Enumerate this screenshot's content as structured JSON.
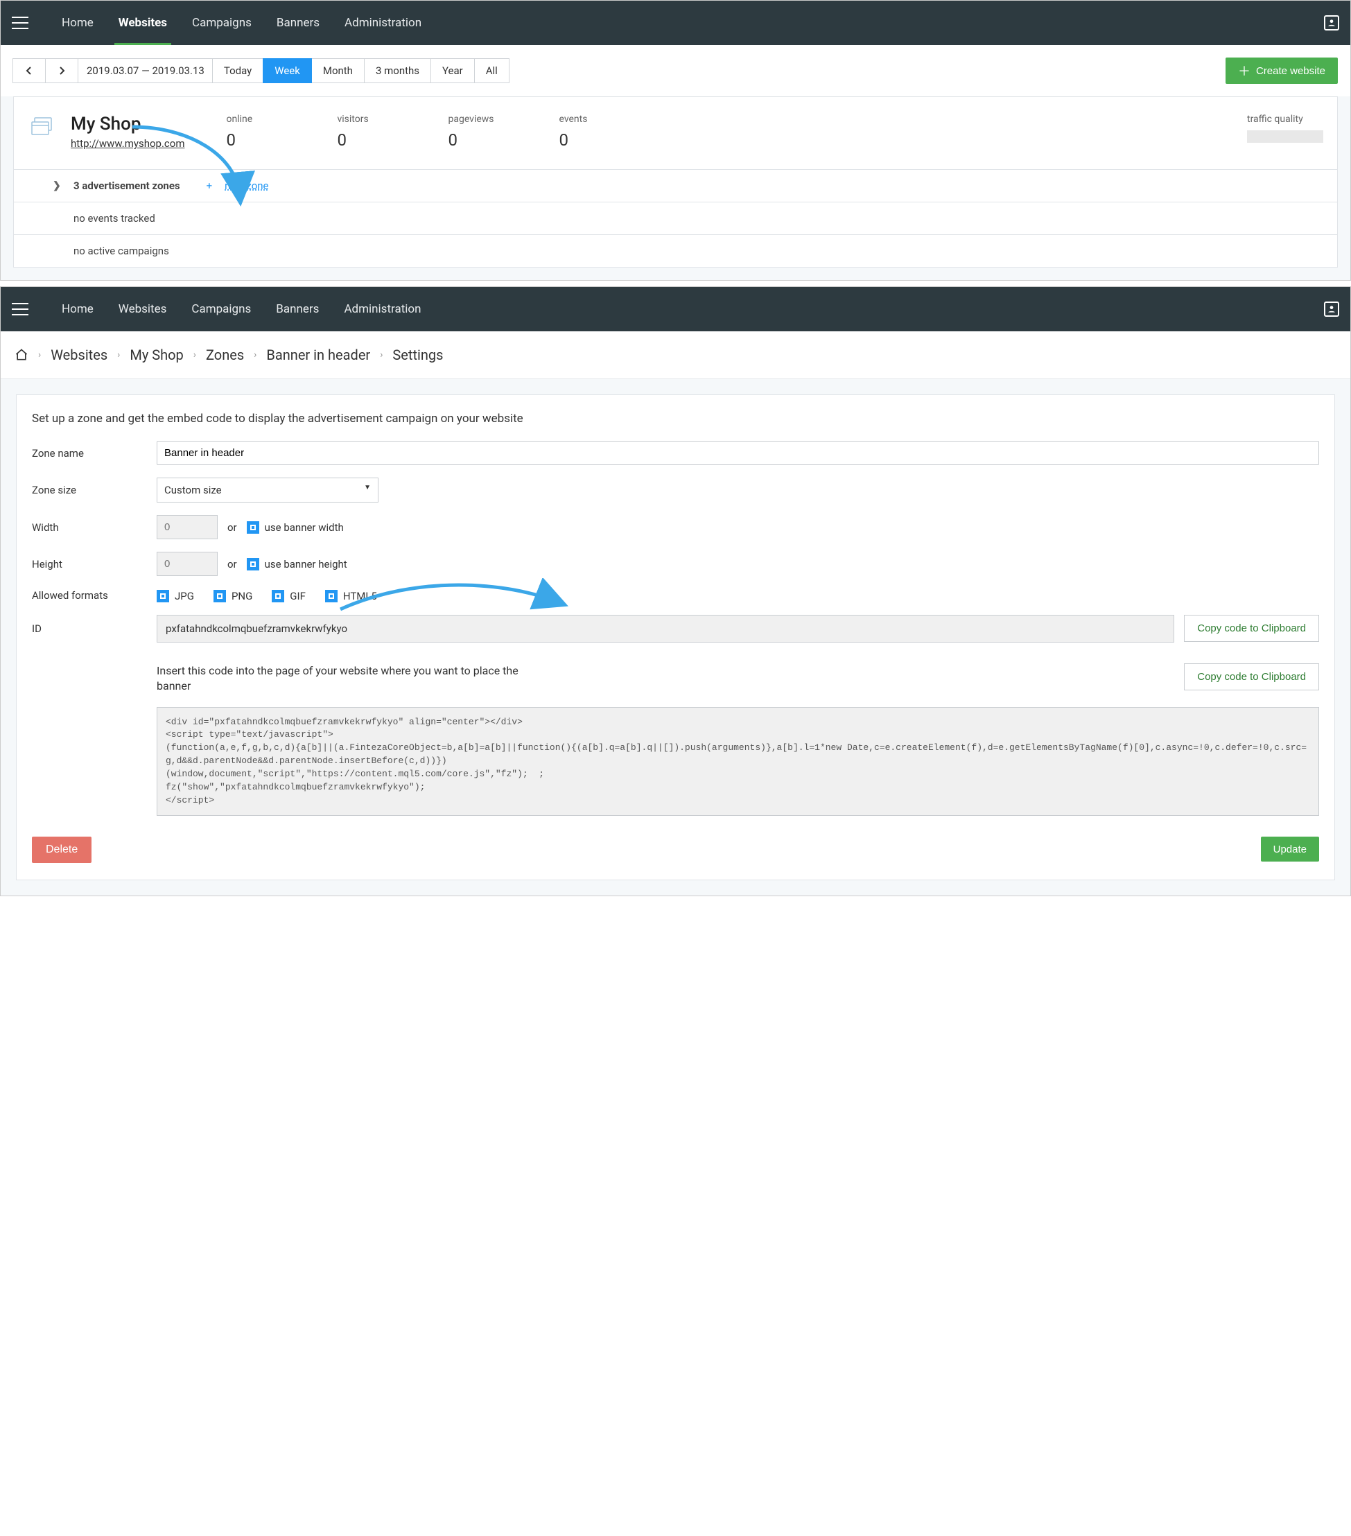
{
  "nav": {
    "items": [
      {
        "label": "Home"
      },
      {
        "label": "Websites"
      },
      {
        "label": "Campaigns"
      },
      {
        "label": "Banners"
      },
      {
        "label": "Administration"
      }
    ]
  },
  "toolbar": {
    "date_range": "2019.03.07  — 2019.03.13",
    "ranges": [
      "Today",
      "Week",
      "Month",
      "3 months",
      "Year",
      "All"
    ],
    "create_website": "Create website"
  },
  "site": {
    "name": "My Shop",
    "url": "http://www.myshop.com",
    "stats": {
      "online_label": "online",
      "online": "0",
      "visitors_label": "visitors",
      "visitors": "0",
      "pageviews_label": "pageviews",
      "pageviews": "0",
      "events_label": "events",
      "events": "0",
      "quality_label": "traffic quality"
    },
    "zones_row": "3 advertisement zones",
    "new_zone": "new zone",
    "no_events": "no events tracked",
    "no_campaigns": "no active campaigns"
  },
  "breadcrumb": {
    "items": [
      "Websites",
      "My Shop",
      "Zones",
      "Banner in header",
      "Settings"
    ]
  },
  "settings": {
    "description": "Set up a zone and get the embed code to display the advertisement campaign on your website",
    "zone_name_label": "Zone name",
    "zone_name_value": "Banner in header",
    "zone_size_label": "Zone size",
    "zone_size_value": "Custom size",
    "width_label": "Width",
    "width_placeholder": "0",
    "or_text": "or",
    "use_banner_width": "use banner width",
    "height_label": "Height",
    "height_placeholder": "0",
    "use_banner_height": "use banner height",
    "formats_label": "Allowed formats",
    "formats": [
      "JPG",
      "PNG",
      "GIF",
      "HTML5"
    ],
    "id_label": "ID",
    "id_value": "pxfatahndkcolmqbuefzramvkekrwfykyo",
    "copy_btn": "Copy code to Clipboard",
    "code_instruct": "Insert this code into the page of your website where you want to place the banner",
    "code_block": "<div id=\"pxfatahndkcolmqbuefzramvkekrwfykyo\" align=\"center\"></div>\n<script type=\"text/javascript\">\n(function(a,e,f,g,b,c,d){a[b]||(a.FintezaCoreObject=b,a[b]=a[b]||function(){(a[b].q=a[b].q||[]).push(arguments)},a[b].l=1*new Date,c=e.createElement(f),d=e.getElementsByTagName(f)[0],c.async=!0,c.defer=!0,c.src=g,d&&d.parentNode&&d.parentNode.insertBefore(c,d))})\n(window,document,\"script\",\"https://content.mql5.com/core.js\",\"fz\");  ;\nfz(\"show\",\"pxfatahndkcolmqbuefzramvkekrwfykyo\");\n</scr_ipt>",
    "delete_btn": "Delete",
    "update_btn": "Update"
  }
}
